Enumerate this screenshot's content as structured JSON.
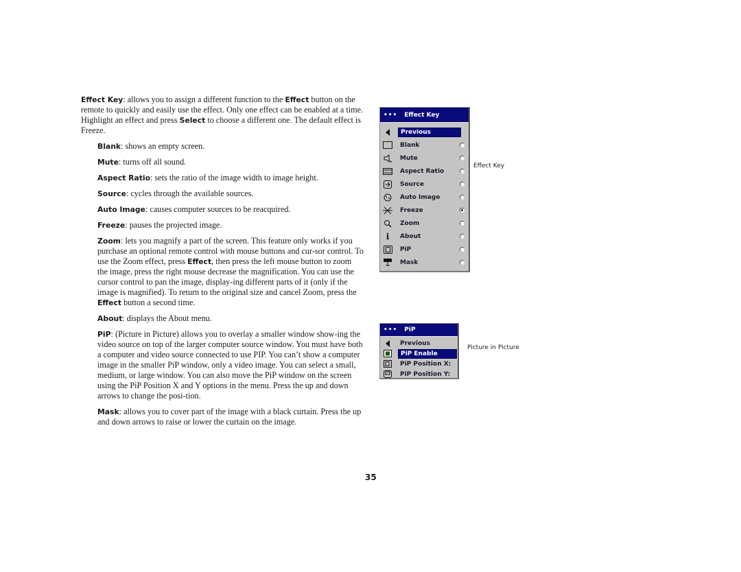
{
  "intro": {
    "term": "Effect Key",
    "text_a": ": allows you to assign a different function to the ",
    "bold_b": "Effect",
    "text_c": " button on the remote to quickly and easily use the effect. Only one effect can be enabled at a time. Highlight an effect and press ",
    "bold_d": "Select",
    "text_e": " to choose a different one. The default effect is Freeze."
  },
  "items": [
    {
      "term": "Blank",
      "desc": ": shows an empty screen."
    },
    {
      "term": "Mute",
      "desc": ": turns off all sound."
    },
    {
      "term": "Aspect Ratio",
      "desc": ": sets the ratio of the image width to image height."
    },
    {
      "term": "Source",
      "desc": ": cycles through the available sources."
    },
    {
      "term": "Auto Image",
      "desc": ": causes computer sources to be reacquired."
    },
    {
      "term": "Freeze",
      "desc": ": pauses the projected image."
    }
  ],
  "zoom": {
    "term": "Zoom",
    "text_a": ": lets you magnify a part of the screen. This feature only works if you purchase an optional remote control with mouse buttons and cur-sor control. To use the Zoom effect, press ",
    "bold_b": "Effect",
    "text_c": ", then press the left mouse button to zoom the image, press the right mouse decrease the magnification. You can use the cursor control to pan the image, display-ing different parts of it (only if the image is magnified). To return to the original size and cancel Zoom, press the ",
    "bold_d": "Effect",
    "text_e": " button a second time."
  },
  "about": {
    "term": "About",
    "desc": ": displays the About menu."
  },
  "pip": {
    "term": "PiP",
    "desc": ": (Picture in Picture) allows you to overlay a smaller window show-ing the video source on top of the larger computer source window. You must have both a computer and video source connected to use PIP. You can’t show a computer image in the smaller PiP window, only a video image. You can select a small, medium, or large window. You can also move the PiP window on the screen using the PiP Position X and Y options in the menu. Press the up and down arrows to change the posi-tion."
  },
  "mask": {
    "term": "Mask",
    "desc": ": allows you to cover part of the image with a black curtain. Press the up and down arrows to raise or lower the curtain on the image."
  },
  "page_number": "35",
  "effect_menu": {
    "title_dots": "•••",
    "title": "Effect Key",
    "caption": "Effect Key",
    "previous": {
      "label": "Previous",
      "icon": "left-arrow-icon",
      "highlighted": true
    },
    "options": [
      {
        "label": "Blank",
        "icon": "blank-screen-icon",
        "selected": false
      },
      {
        "label": "Mute",
        "icon": "mute-icon",
        "selected": false
      },
      {
        "label": "Aspect Ratio",
        "icon": "aspect-ratio-icon",
        "selected": false
      },
      {
        "label": "Source",
        "icon": "source-icon",
        "selected": false
      },
      {
        "label": "Auto Image",
        "icon": "auto-image-icon",
        "selected": false
      },
      {
        "label": "Freeze",
        "icon": "freeze-icon",
        "selected": true
      },
      {
        "label": "Zoom",
        "icon": "zoom-icon",
        "selected": false
      },
      {
        "label": "About",
        "icon": "info-icon",
        "selected": false
      },
      {
        "label": "PiP",
        "icon": "pip-icon",
        "selected": false
      },
      {
        "label": "Mask",
        "icon": "mask-icon",
        "selected": false
      }
    ]
  },
  "pip_menu": {
    "title_dots": "•••",
    "title": "PiP",
    "caption": "Picture in Picture",
    "items": [
      {
        "label": "Previous",
        "icon": "left-arrow-icon"
      },
      {
        "label": "PiP Enable",
        "icon": "checkbox-enabled-icon",
        "highlighted": true
      },
      {
        "label": "PiP Position X:",
        "icon": "pip-position-x-icon"
      },
      {
        "label": "PiP Position Y:",
        "icon": "pip-position-y-icon"
      }
    ]
  },
  "colors": {
    "menu_title_bg": "#0a0a7a",
    "menu_bg": "#c4c4c4",
    "highlight_bg": "#0a0a7a"
  }
}
